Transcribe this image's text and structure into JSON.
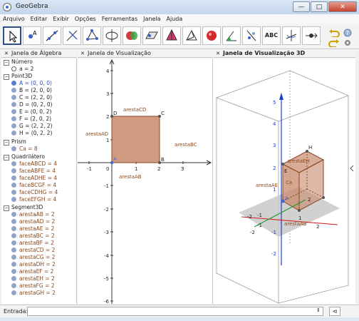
{
  "window": {
    "title": "GeoGebra",
    "min": "—",
    "max": "□",
    "close": "✕"
  },
  "menu": [
    "Arquivo",
    "Editar",
    "Exibir",
    "Opções",
    "Ferramentas",
    "Janela",
    "Ajuda"
  ],
  "toolbar": {
    "text_tool": "ABC"
  },
  "panels": {
    "algebra": "Janela de Álgebra",
    "graphics": "Janela de Visualização",
    "view3d": "Janela de Visualização 3D"
  },
  "algebra": {
    "numero": {
      "title": "Número",
      "items": [
        "a = 2"
      ]
    },
    "point3d": {
      "title": "Point3D",
      "items": [
        "A = (0, 0, 0)",
        "B = (2, 0, 0)",
        "C = (2, 2, 0)",
        "D = (0, 2, 0)",
        "E = (0, 0, 2)",
        "F = (2, 0, 2)",
        "G = (2, 2, 2)",
        "H = (0, 2, 2)"
      ]
    },
    "prism": {
      "title": "Prism",
      "items": [
        "Ca = 8"
      ]
    },
    "quad": {
      "title": "Quadrilátero",
      "items": [
        "faceABCD = 4",
        "faceABFE = 4",
        "faceADHE = 4",
        "faceBCGF = 4",
        "faceCDHG = 4",
        "faceEFGH = 4"
      ]
    },
    "seg": {
      "title": "Segment3D",
      "items": [
        "arestaAB = 2",
        "arestaAD = 2",
        "arestaAE = 2",
        "arestaBC = 2",
        "arestaBF = 2",
        "arestaCD = 2",
        "arestaCG = 2",
        "arestaDH = 2",
        "arestaEF = 2",
        "arestaEH = 2",
        "arestaFG = 2",
        "arestaGH = 2"
      ]
    }
  },
  "graphics": {
    "x_ticks": [
      "-1",
      "1",
      "2",
      "3"
    ],
    "y_ticks": [
      "4",
      "3",
      "2",
      "1",
      "-1",
      "-2",
      "-3",
      "-4",
      "-5",
      "-6"
    ],
    "origin": "0",
    "points": {
      "A": "A",
      "B": "B",
      "C": "C",
      "D": "D"
    },
    "labels": {
      "top": "arestaCD",
      "left": "arestaAD",
      "right": "arestaBC",
      "bottom": "arestaAB"
    }
  },
  "view3d": {
    "z_ticks": [
      "5",
      "4",
      "3",
      "2",
      "1",
      "-1",
      "-2"
    ],
    "labels": {
      "eh": "arestaEH",
      "ae": "arestaAE",
      "ab": "arestaAB",
      "ca": "Ca",
      "e": "E",
      "a": "A",
      "h": "H"
    },
    "axis_ticks": [
      "-1",
      "-2",
      "1",
      "2",
      "2",
      "-1",
      "-2"
    ]
  },
  "input": {
    "label": "Entrada:",
    "value": ""
  },
  "colors": {
    "face": "#c8896b",
    "point_blue": "#4466cc",
    "highlight": "#2d4f8f",
    "axis3d": "#1a3fc8"
  }
}
